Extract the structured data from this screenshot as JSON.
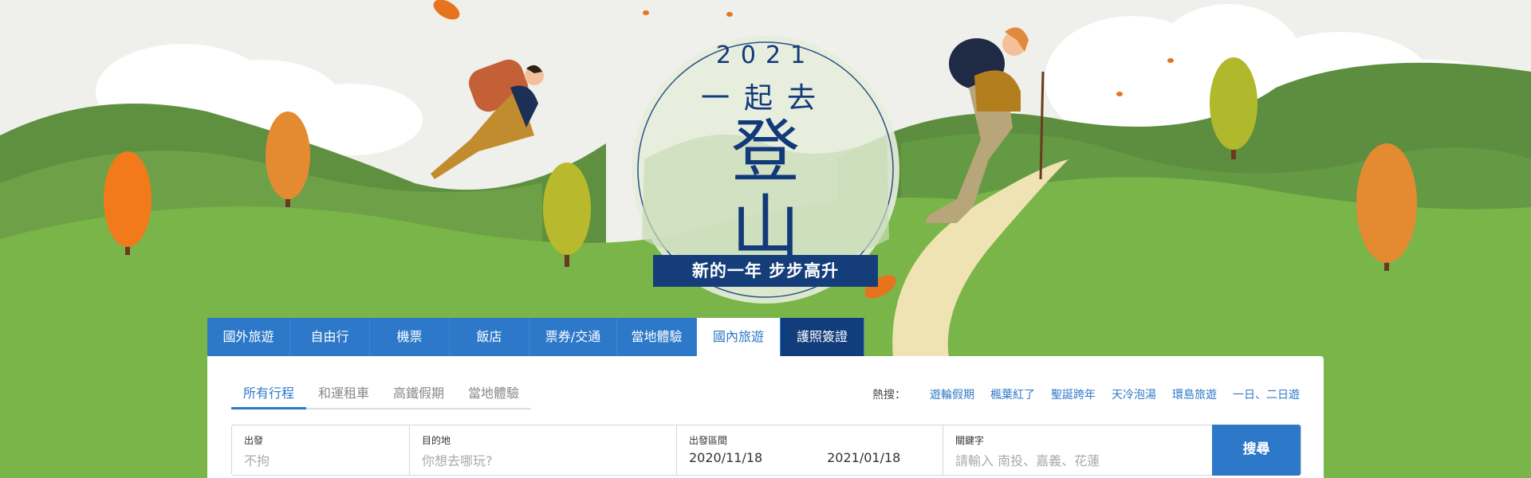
{
  "colors": {
    "primary": "#2d78c8",
    "navy": "#123d7c",
    "grass": "#79b548"
  },
  "hero": {
    "year": "2021",
    "line": "一起去",
    "main_top": "登",
    "main_bottom": "山",
    "slogan": "新的一年 步步高升"
  },
  "tabs": [
    "國外旅遊",
    "自由行",
    "機票",
    "飯店",
    "票券/交通",
    "當地體驗",
    "國內旅遊",
    "護照簽證"
  ],
  "subtabs": [
    "所有行程",
    "和運租車",
    "高鐵假期",
    "當地體驗"
  ],
  "hot": {
    "label": "熱搜：",
    "items": [
      "遊輪假期",
      "楓葉紅了",
      "聖誕跨年",
      "天冷泡湯",
      "環島旅遊",
      "一日、二日遊"
    ]
  },
  "search": {
    "depart_label": "出發",
    "depart_value": "不拘",
    "dest_label": "目的地",
    "dest_placeholder": "你想去哪玩?",
    "period_label": "出發區間",
    "date_from": "2020/11/18",
    "date_to": "2021/01/18",
    "keyword_label": "關鍵字",
    "keyword_placeholder": "請輸入 南投、嘉義、花蓮",
    "button": "搜尋"
  }
}
